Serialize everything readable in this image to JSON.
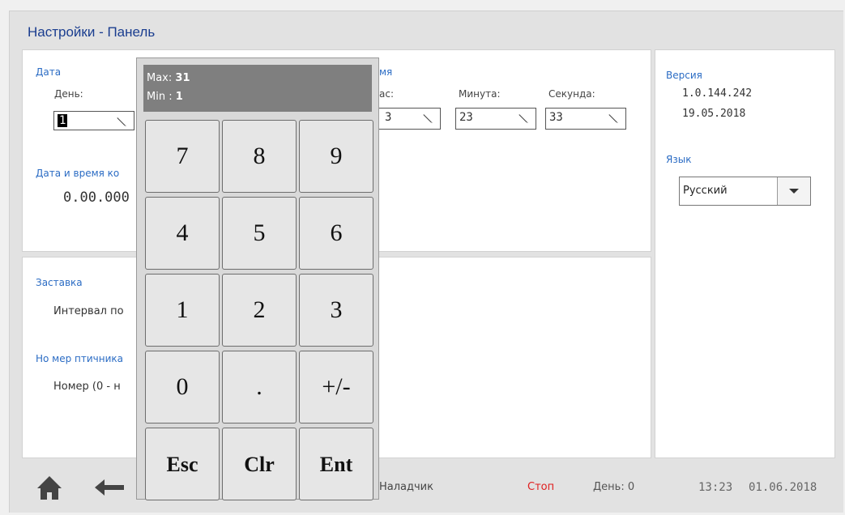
{
  "page": {
    "title": "Настройки - Панель"
  },
  "date_section": {
    "label": "Дата",
    "day_label": "День:",
    "day_value": "1"
  },
  "time_section": {
    "label_partial": "мя",
    "hour_label_partial": "ас:",
    "hour_value_partial": "3",
    "minute_label": "Минута:",
    "minute_value": "23",
    "second_label": "Секунда:",
    "second_value": "33"
  },
  "controller_datetime": {
    "label_partial": "Дата и время ко",
    "value_partial": "0.00.000"
  },
  "screensaver": {
    "label": "Заставка",
    "interval_partial": "Интервал по"
  },
  "house_number": {
    "label_partial": "Но мер птичника",
    "number_partial": "Номер (0 - н"
  },
  "version": {
    "label": "Версия",
    "number": "1.0.144.242",
    "date": "19.05.2018"
  },
  "language": {
    "label": "Язык",
    "selected": "Русский"
  },
  "keypad": {
    "max_label": "Max:",
    "max_value": "31",
    "min_label": "Min :",
    "min_value": "1",
    "keys": [
      "7",
      "8",
      "9",
      "4",
      "5",
      "6",
      "1",
      "2",
      "3",
      "0",
      ".",
      "+/-",
      "Esc",
      "Clr",
      "Ent"
    ]
  },
  "status_bar": {
    "user": "Наладчик",
    "state": "Стоп",
    "day_text": "День: 0",
    "time": "13:23",
    "date": "01.06.2018"
  },
  "colors": {
    "title": "#1a3d8f",
    "section_label": "#2b6cc4",
    "stop": "#e02020"
  },
  "icons": [
    "pencil-icon",
    "home-icon",
    "back-arrow-icon",
    "dropdown-arrow-icon"
  ]
}
